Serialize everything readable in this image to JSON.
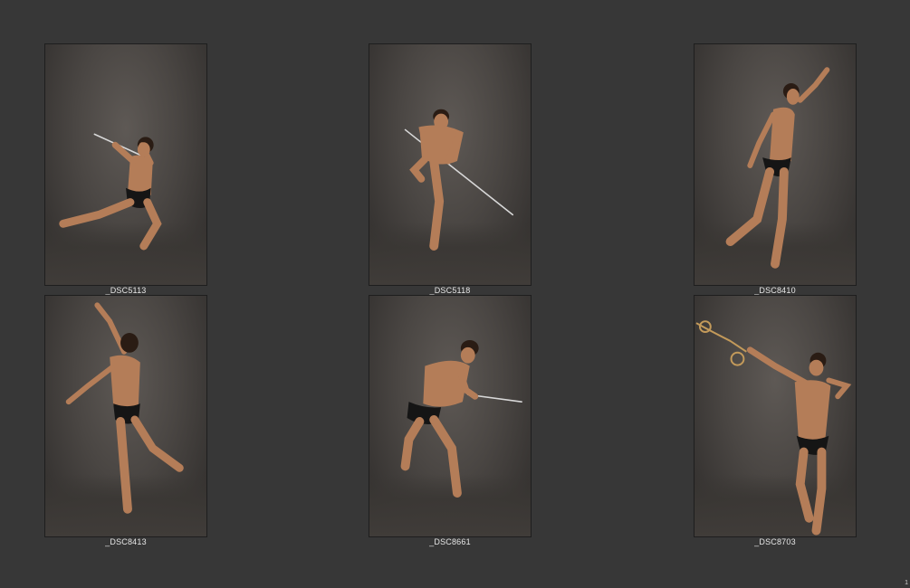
{
  "contact_sheet": {
    "page_number": "1",
    "photos": [
      {
        "filename": "_DSC5113",
        "pose": "crouching-lunge-sword-overhead"
      },
      {
        "filename": "_DSC5118",
        "pose": "forward-step-sword-low"
      },
      {
        "filename": "_DSC8410",
        "pose": "reaching-up-kick-back"
      },
      {
        "filename": "_DSC8413",
        "pose": "back-view-arm-raised"
      },
      {
        "filename": "_DSC8661",
        "pose": "lunge-dagger-thrust"
      },
      {
        "filename": "_DSC8703",
        "pose": "pulling-rope-overhead"
      }
    ]
  }
}
